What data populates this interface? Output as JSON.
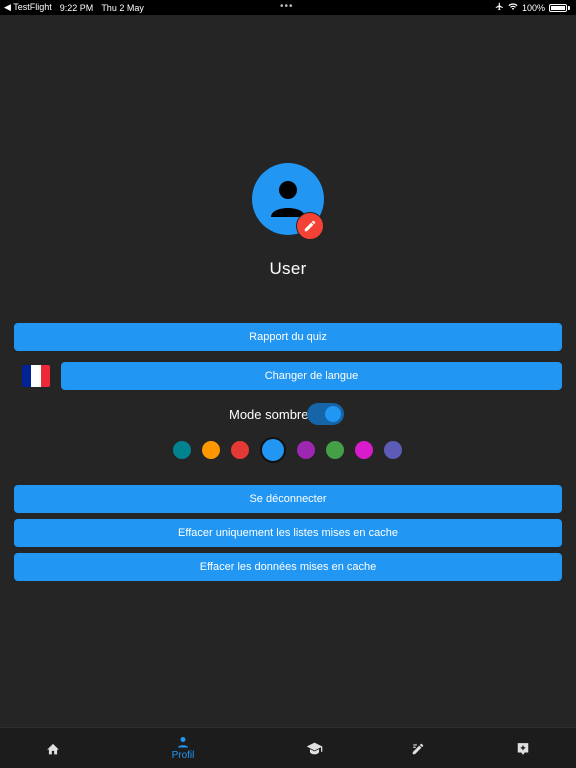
{
  "status_bar": {
    "back_app": "◀ TestFlight",
    "time": "9:22 PM",
    "date": "Thu 2 May",
    "dots": "•••",
    "battery": "100%"
  },
  "profile": {
    "username": "User",
    "avatar_icon": "person-icon",
    "edit_icon": "pencil-icon"
  },
  "buttons": {
    "quiz_report": "Rapport du quiz",
    "change_language": "Changer de langue",
    "logout": "Se déconnecter",
    "clear_cached_lists": "Effacer uniquement les listes mises en cache",
    "clear_cached_data": "Effacer les données mises en cache"
  },
  "language": {
    "flag": "france-flag",
    "flag_colors": [
      "#002395",
      "#ffffff",
      "#ed2939"
    ]
  },
  "dark_mode": {
    "label": "Mode sombre",
    "enabled": true
  },
  "theme_colors": {
    "selected_index": 3,
    "swatches": [
      "#00838f",
      "#ff9800",
      "#e53935",
      "#2196f3",
      "#9c27b0",
      "#43a047",
      "#d81bcb",
      "#5c5cb8"
    ]
  },
  "tab_bar": {
    "active_index": 1,
    "tabs": [
      {
        "icon": "home-icon",
        "label": ""
      },
      {
        "icon": "person-icon",
        "label": "Profil"
      },
      {
        "icon": "graduation-cap-icon",
        "label": ""
      },
      {
        "icon": "edit-note-icon",
        "label": ""
      },
      {
        "icon": "sparkle-badge-icon",
        "label": ""
      }
    ]
  },
  "colors": {
    "accent": "#2196f3",
    "background": "#252525",
    "badge_red": "#f44336"
  }
}
